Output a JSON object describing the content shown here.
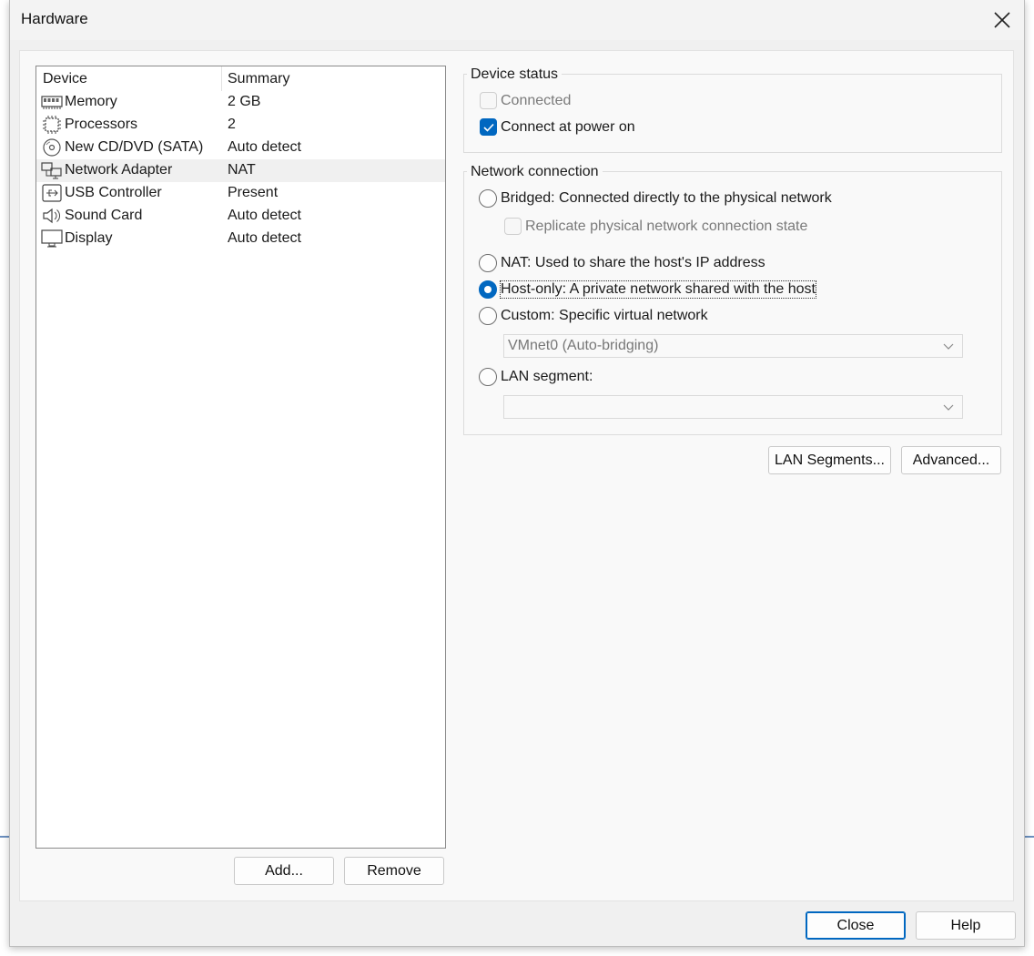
{
  "window": {
    "title": "Hardware"
  },
  "device_list": {
    "headers": {
      "device": "Device",
      "summary": "Summary"
    },
    "rows": [
      {
        "name": "Memory",
        "summary": "2 GB",
        "icon": "memory-icon"
      },
      {
        "name": "Processors",
        "summary": "2",
        "icon": "processor-icon"
      },
      {
        "name": "New CD/DVD (SATA)",
        "summary": "Auto detect",
        "icon": "cd-dvd-icon"
      },
      {
        "name": "Network Adapter",
        "summary": "NAT",
        "icon": "network-adapter-icon",
        "selected": true
      },
      {
        "name": "USB Controller",
        "summary": "Present",
        "icon": "usb-icon"
      },
      {
        "name": "Sound Card",
        "summary": "Auto detect",
        "icon": "speaker-icon"
      },
      {
        "name": "Display",
        "summary": "Auto detect",
        "icon": "monitor-icon"
      }
    ],
    "add_label": "Add...",
    "remove_label": "Remove"
  },
  "device_status": {
    "label": "Device status",
    "connected": {
      "label": "Connected",
      "checked": false,
      "enabled": false
    },
    "connect_at_power_on": {
      "label": "Connect at power on",
      "checked": true,
      "enabled": true
    }
  },
  "network_connection": {
    "label": "Network connection",
    "bridged": {
      "label": "Bridged: Connected directly to the physical network",
      "selected": false
    },
    "replicate": {
      "label": "Replicate physical network connection state",
      "checked": false,
      "enabled": false
    },
    "nat": {
      "label": "NAT: Used to share the host's IP address",
      "selected": false
    },
    "host_only": {
      "label": "Host-only: A private network shared with the host",
      "selected": true
    },
    "custom": {
      "label": "Custom: Specific virtual network",
      "selected": false
    },
    "custom_select": {
      "value": "VMnet0 (Auto-bridging)",
      "enabled": false
    },
    "lan_segment": {
      "label": "LAN segment:",
      "selected": false
    },
    "lan_select": {
      "value": "",
      "enabled": false
    }
  },
  "buttons": {
    "lan_segments": "LAN Segments...",
    "advanced": "Advanced...",
    "close": "Close",
    "help": "Help"
  },
  "colors": {
    "accent": "#0067c0",
    "selected_row": "#f0f0f0"
  }
}
